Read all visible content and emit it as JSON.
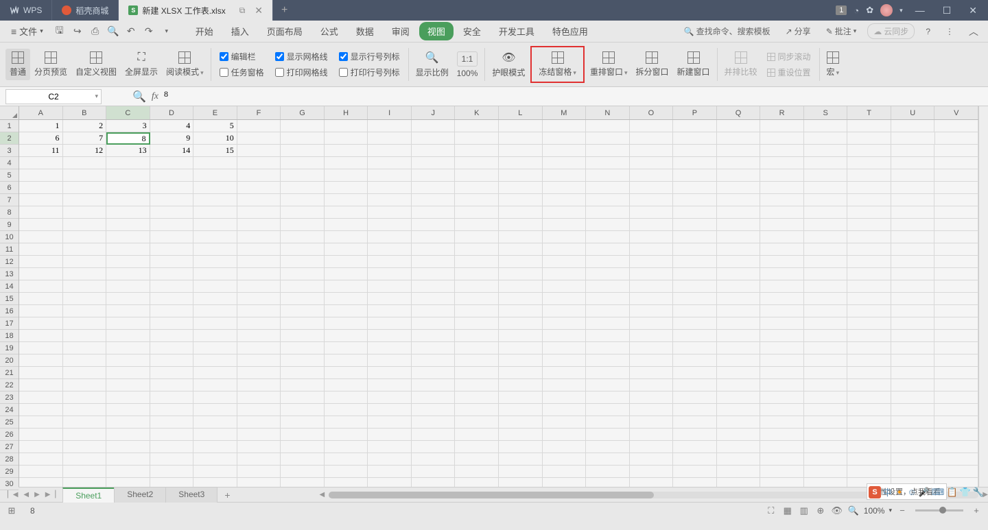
{
  "titlebar": {
    "app_name": "WPS",
    "store_tab": "稻壳商城",
    "doc_tab": "新建 XLSX 工作表.xlsx",
    "counter": "1"
  },
  "menubar": {
    "file": "文件",
    "tabs": [
      "开始",
      "插入",
      "页面布局",
      "公式",
      "数据",
      "审阅",
      "视图",
      "安全",
      "开发工具",
      "特色应用"
    ],
    "active_tab_index": 6,
    "search_placeholder": "查找命令、搜索模板",
    "share": "分享",
    "annotate": "批注",
    "cloud_sync": "云同步"
  },
  "ribbon": {
    "normal": "普通",
    "page_preview": "分页预览",
    "custom_view": "自定义视图",
    "fullscreen": "全屏显示",
    "read_mode": "阅读模式",
    "formula_bar_chk": "编辑栏",
    "gridlines_chk": "显示网格线",
    "rowcol_chk": "显示行号列标",
    "task_pane_chk": "任务窗格",
    "print_grid_chk": "打印网格线",
    "print_rowcol_chk": "打印行号列标",
    "zoom_ratio": "显示比例",
    "hundred_pct": "100%",
    "eye_care": "护眼模式",
    "freeze_panes": "冻结窗格",
    "arrange_win": "重排窗口",
    "split_win": "拆分窗口",
    "new_win": "新建窗口",
    "side_by_side": "并排比较",
    "sync_scroll": "同步滚动",
    "reset_pos": "重设位置",
    "macro": "宏"
  },
  "formula_bar": {
    "name_box": "C2",
    "formula_value": "8"
  },
  "grid": {
    "columns": [
      "A",
      "B",
      "C",
      "D",
      "E",
      "F",
      "G",
      "H",
      "I",
      "J",
      "K",
      "L",
      "M",
      "N",
      "O",
      "P",
      "Q",
      "R",
      "S",
      "T",
      "U",
      "V"
    ],
    "active_col_index": 2,
    "rows_count": 30,
    "active_row_index": 1,
    "data": [
      [
        "1",
        "2",
        "3",
        "4",
        "5"
      ],
      [
        "6",
        "7",
        "8",
        "9",
        "10"
      ],
      [
        "11",
        "12",
        "13",
        "14",
        "15"
      ]
    ],
    "selected": {
      "row": 1,
      "col": 2
    }
  },
  "sheet_bar": {
    "tabs": [
      "Sheet1",
      "Sheet2",
      "Sheet3"
    ],
    "active_index": 0
  },
  "status_bar": {
    "value": "8",
    "tooltip": "个性设置，点我看看",
    "zoom_pct": "100%"
  }
}
